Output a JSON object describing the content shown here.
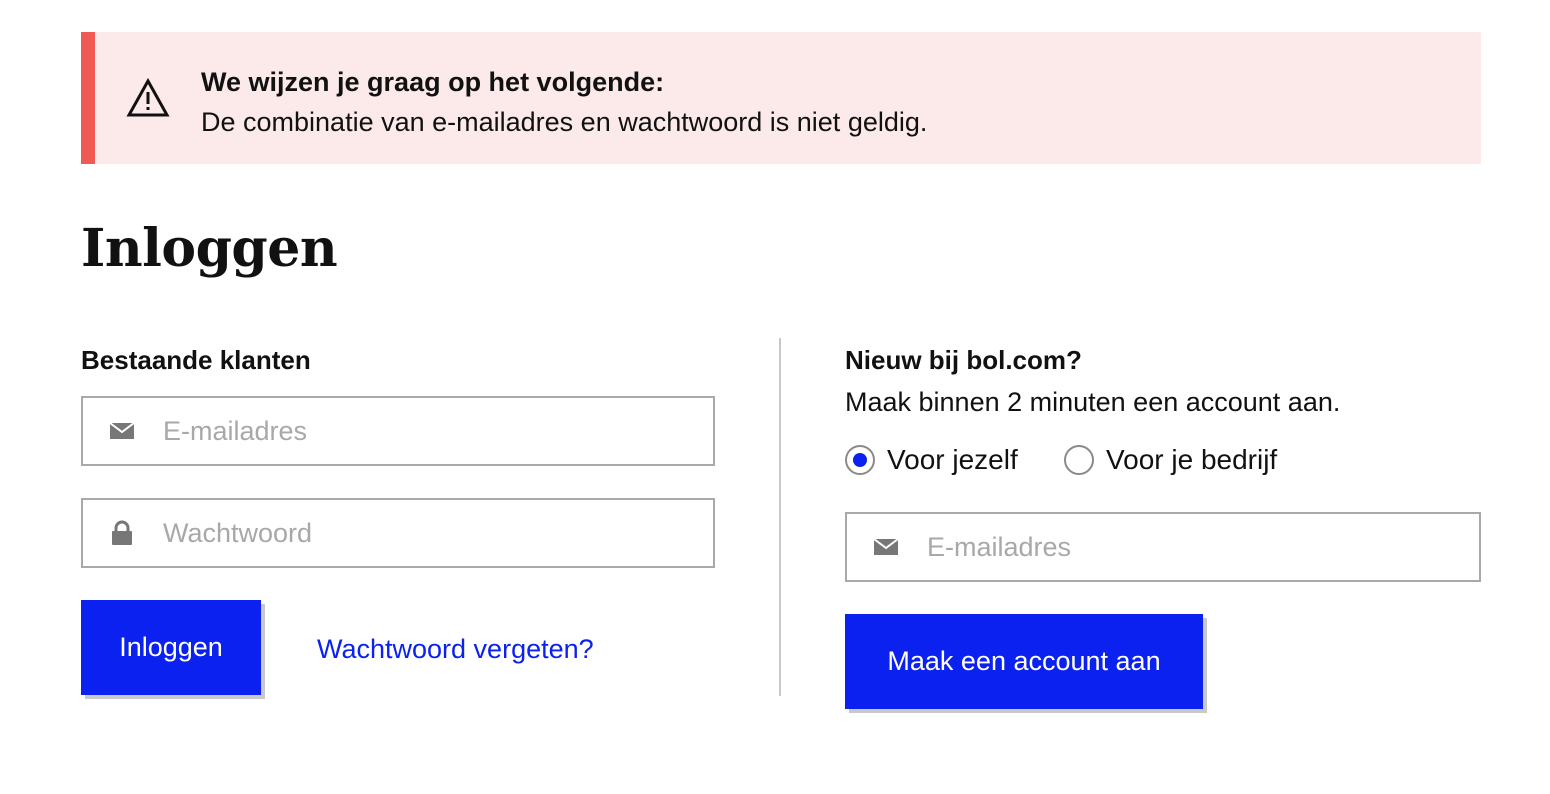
{
  "alert": {
    "title": "We wijzen je graag op het volgende:",
    "message": "De combinatie van e-mailadres en wachtwoord is niet geldig.",
    "icon": "warning-icon",
    "bar_color": "#ef5b54",
    "background": "#fceaea"
  },
  "page": {
    "title": "Inloggen"
  },
  "login": {
    "heading": "Bestaande klanten",
    "email_placeholder": "E-mailadres",
    "email_icon": "mail-icon",
    "password_placeholder": "Wachtwoord",
    "password_icon": "lock-icon",
    "submit_label": "Inloggen",
    "forgot_label": "Wachtwoord vergeten?"
  },
  "register": {
    "heading": "Nieuw bij bol.com?",
    "subtext": "Maak binnen 2 minuten een account aan.",
    "options": [
      {
        "label": "Voor jezelf",
        "checked": true
      },
      {
        "label": "Voor je bedrijf",
        "checked": false
      }
    ],
    "email_placeholder": "E-mailadres",
    "email_icon": "mail-icon",
    "submit_label": "Maak een account aan"
  },
  "colors": {
    "accent": "#0b21f0",
    "border": "#a9a9a9",
    "placeholder": "#a8a8a8"
  }
}
